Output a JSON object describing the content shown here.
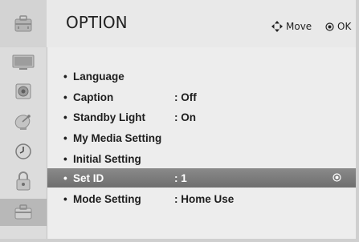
{
  "header": {
    "title": "OPTION",
    "icon": "option-briefcase-icon",
    "hint_move_icon": "four-way-arrow-icon",
    "hint_move_label": "Move",
    "hint_ok_icon": "ok-circle-icon",
    "hint_ok_label": "OK"
  },
  "sidebar": {
    "items": [
      {
        "icon": "picture-tv-icon",
        "selected": false
      },
      {
        "icon": "audio-speaker-icon",
        "selected": false
      },
      {
        "icon": "setup-satellite-icon",
        "selected": false
      },
      {
        "icon": "time-clock-icon",
        "selected": false
      },
      {
        "icon": "lock-icon",
        "selected": false
      },
      {
        "icon": "option-briefcase-icon",
        "selected": true
      }
    ]
  },
  "menu": {
    "items": [
      {
        "label": "Language",
        "value": ""
      },
      {
        "label": "Caption",
        "value": ": Off"
      },
      {
        "label": "Standby Light",
        "value": ": On"
      },
      {
        "label": "My Media Setting",
        "value": ""
      },
      {
        "label": "Initial Setting",
        "value": ""
      },
      {
        "label": "Set ID",
        "value": ": 1",
        "selected": true
      },
      {
        "label": "Mode Setting",
        "value": ": Home Use"
      }
    ],
    "bullet": "•"
  },
  "colors": {
    "panel_bg": "#ededed",
    "sidebar_bg": "#dcdcdc",
    "selected_row": "#7c7c7c",
    "selected_text": "#ffffff"
  }
}
